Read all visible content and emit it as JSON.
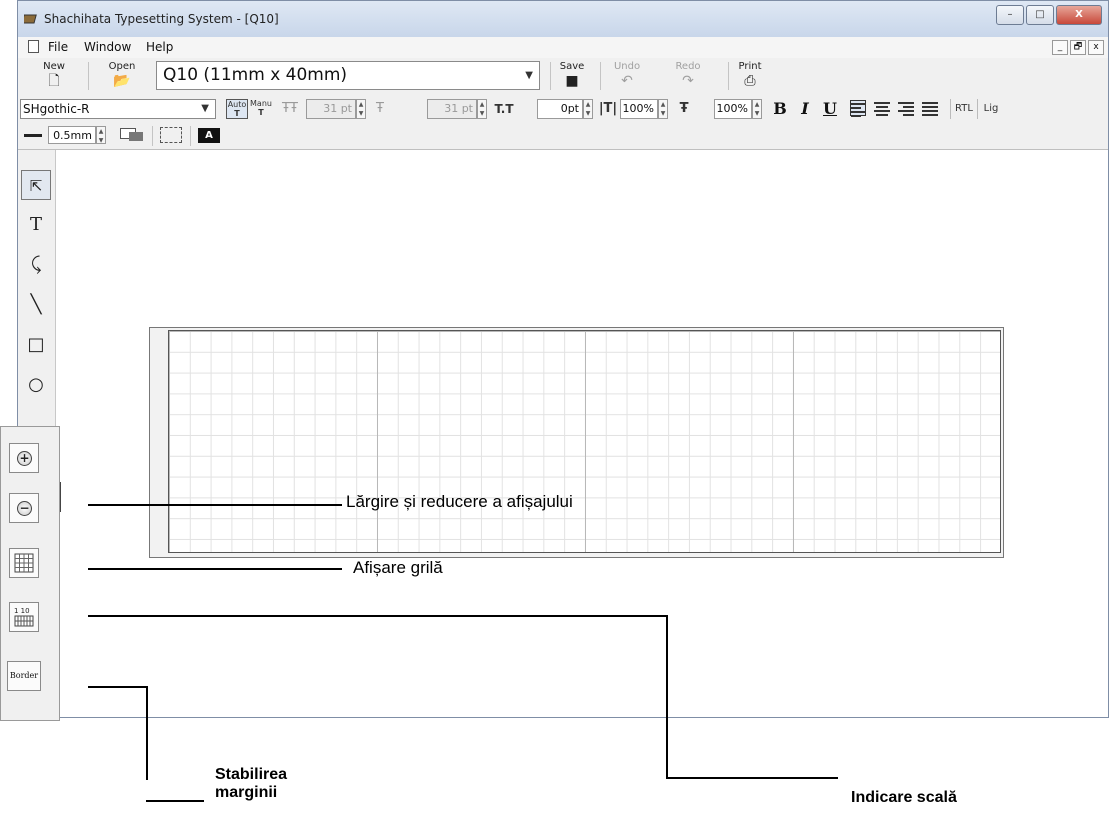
{
  "window": {
    "title": "Shachihata Typesetting System - [Q10]",
    "buttons": [
      "–",
      "□",
      "X"
    ]
  },
  "menu": {
    "items": [
      "File",
      "Window",
      "Help"
    ],
    "mdi_buttons": [
      "_",
      "🗗",
      "x"
    ]
  },
  "toolbar": {
    "new_label": "New",
    "open_label": "Open",
    "label_size": "Q10 (11mm x 40mm)",
    "save_label": "Save",
    "undo_label": "Undo",
    "redo_label": "Redo",
    "print_label": "Print"
  },
  "format_bar": {
    "font": "SHgothic-R",
    "auto_label": "Auto",
    "manu_label": "Manu",
    "font_size_1": "31 pt",
    "font_size_2": "31 pt",
    "spacing": "0pt",
    "width_scale": "100%",
    "height_scale": "100%",
    "bold": "B",
    "italic": "I",
    "underline": "U",
    "rtl": "RTL",
    "lig": "Lig"
  },
  "line_bar": {
    "thickness": "0.5mm"
  },
  "tools": {
    "text_tool": "T"
  },
  "annotations": {
    "zoom": "Lărgire și reducere a afișajului",
    "grid": "Afișare grilă",
    "border_line1": "Stabilirea",
    "border_line2": "marginii",
    "scale": "Indicare scală",
    "border_button": "Border"
  },
  "colors": {
    "title_bar": "#c8d6ea",
    "close_button": "#c8483a",
    "toolbar_bg": "#f0f0f0"
  }
}
